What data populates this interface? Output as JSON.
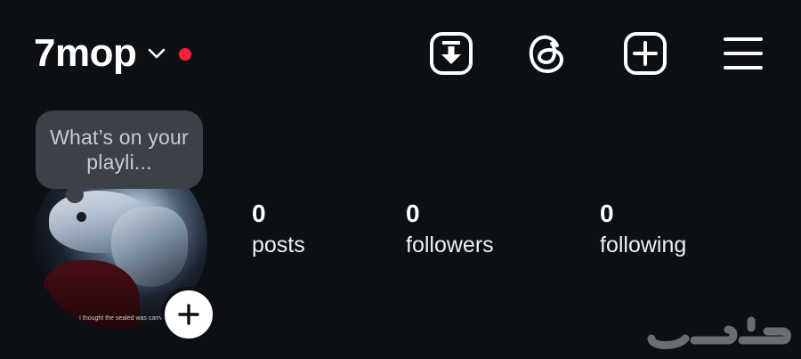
{
  "header": {
    "username": "7mop",
    "icons": {
      "chevron": "chevron-down-icon",
      "download": "download-box-icon",
      "threads": "threads-icon",
      "create": "plus-square-icon",
      "menu": "hamburger-menu-icon"
    }
  },
  "profile": {
    "note": "What’s on your playli...",
    "avatar_caption": "I thought the sealed was carry"
  },
  "stats": [
    {
      "value": "0",
      "label": "posts"
    },
    {
      "value": "0",
      "label": "followers"
    },
    {
      "value": "0",
      "label": "following"
    }
  ],
  "colors": {
    "background": "#0c0f14",
    "notification_dot": "#ff1f3d",
    "note_bubble": "#3c4048",
    "text": "#ffffff"
  },
  "watermark": "haraj-logo"
}
